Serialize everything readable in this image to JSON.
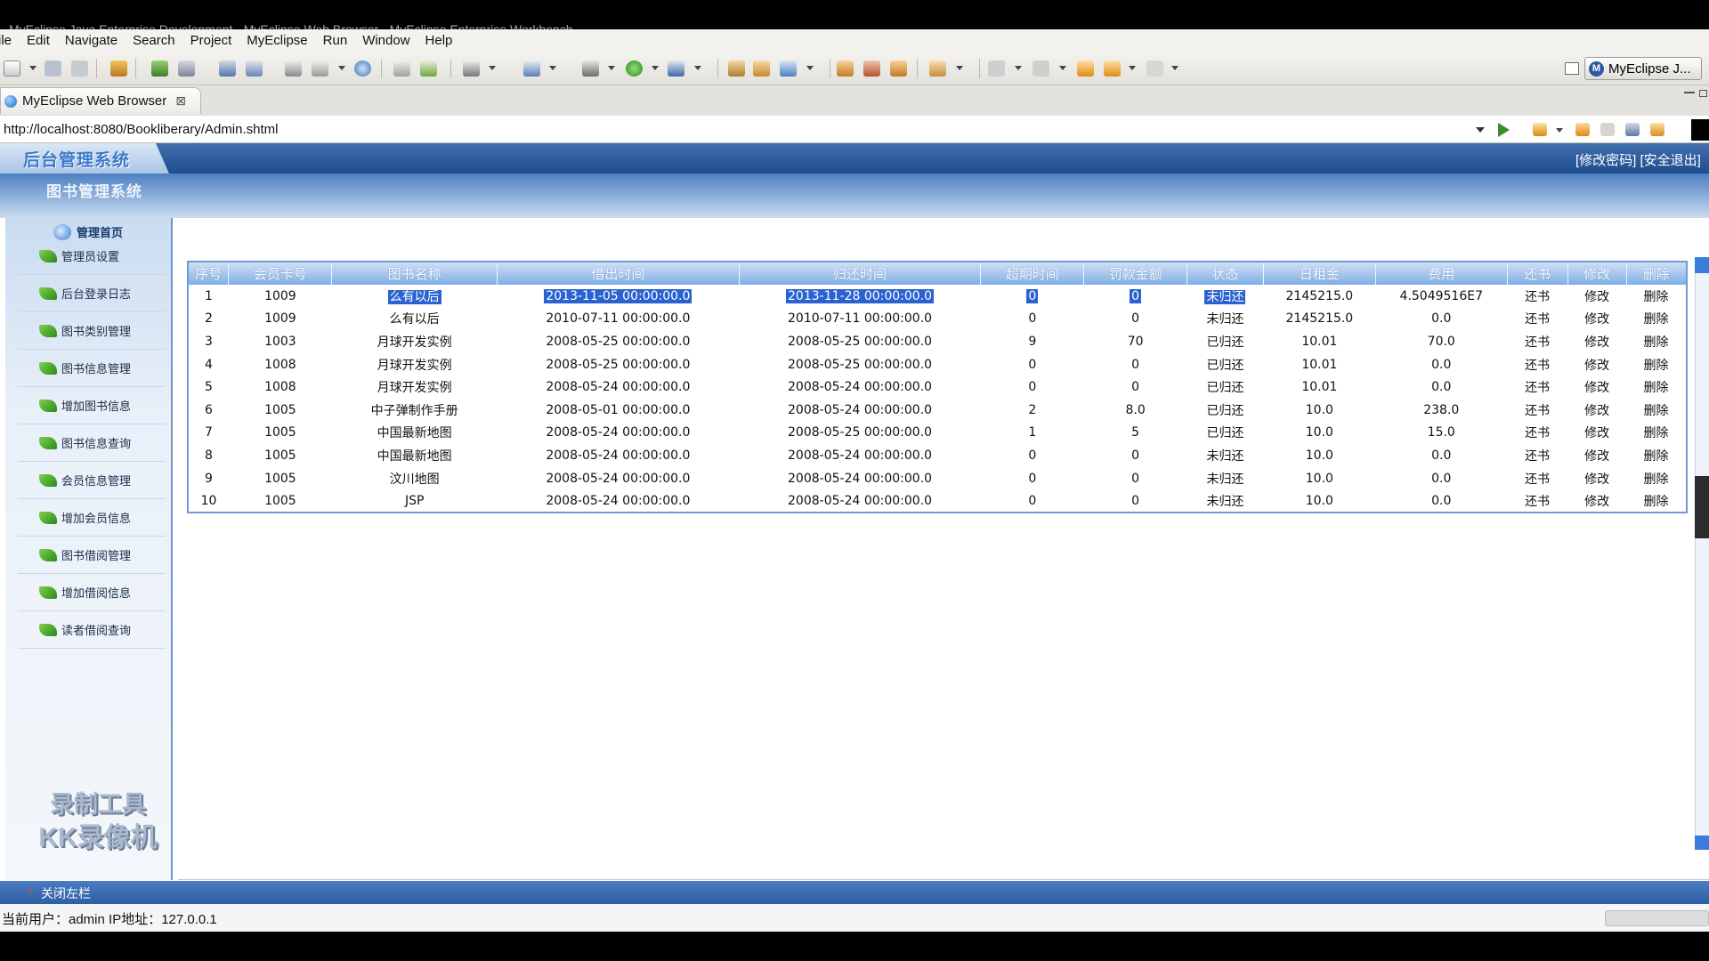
{
  "window": {
    "title": "MyEclipse Java Enterprise Development - MyEclipse Web Browser - MyEclipse Enterprise Workbench"
  },
  "menu": [
    "ile",
    "Edit",
    "Navigate",
    "Search",
    "Project",
    "MyEclipse",
    "Run",
    "Window",
    "Help"
  ],
  "perspective": {
    "label": "MyEclipse J...",
    "icon": "myeclipse-icon"
  },
  "editor_tab": {
    "label": "MyEclipse Web Browser",
    "close": "⊠"
  },
  "browser": {
    "url": "http://localhost:8080/Bookliberary/Admin.shtml"
  },
  "page": {
    "logo": "后台管理系统",
    "subtitle": "图书管理系统",
    "top_links": "[修改密码] [安全退出]",
    "sidebar": {
      "home": "管理首页",
      "items": [
        "管理员设置",
        "后台登录日志",
        "图书类别管理",
        "图书信息管理",
        "增加图书信息",
        "图书信息查询",
        "会员信息管理",
        "增加会员信息",
        "图书借阅管理",
        "增加借阅信息",
        "读者借阅查询"
      ]
    },
    "watermark": {
      "line1": "录制工具",
      "line2": "KK录像机"
    },
    "table": {
      "columns": [
        "序号",
        "会员卡号",
        "图书名称",
        "借出时间",
        "归还时间",
        "超期时间",
        "罚款金额",
        "状态",
        "日租金",
        "费用",
        "还书",
        "修改",
        "删除"
      ],
      "rows": [
        [
          "1",
          "1009",
          "么有以后",
          "2013-11-05 00:00:00.0",
          "2013-11-28 00:00:00.0",
          "0",
          "0",
          "未归还",
          "2145215.0",
          "4.5049516E7",
          "还书",
          "修改",
          "删除"
        ],
        [
          "2",
          "1009",
          "么有以后",
          "2010-07-11 00:00:00.0",
          "2010-07-11 00:00:00.0",
          "0",
          "0",
          "未归还",
          "2145215.0",
          "0.0",
          "还书",
          "修改",
          "删除"
        ],
        [
          "3",
          "1003",
          "月球开发实例",
          "2008-05-25 00:00:00.0",
          "2008-05-25 00:00:00.0",
          "9",
          "70",
          "已归还",
          "10.01",
          "70.0",
          "还书",
          "修改",
          "删除"
        ],
        [
          "4",
          "1008",
          "月球开发实例",
          "2008-05-25 00:00:00.0",
          "2008-05-25 00:00:00.0",
          "0",
          "0",
          "已归还",
          "10.01",
          "0.0",
          "还书",
          "修改",
          "删除"
        ],
        [
          "5",
          "1008",
          "月球开发实例",
          "2008-05-24 00:00:00.0",
          "2008-05-24 00:00:00.0",
          "0",
          "0",
          "已归还",
          "10.01",
          "0.0",
          "还书",
          "修改",
          "删除"
        ],
        [
          "6",
          "1005",
          "中子弹制作手册",
          "2008-05-01 00:00:00.0",
          "2008-05-24 00:00:00.0",
          "2",
          "8.0",
          "已归还",
          "10.0",
          "238.0",
          "还书",
          "修改",
          "删除"
        ],
        [
          "7",
          "1005",
          "中国最新地图",
          "2008-05-24 00:00:00.0",
          "2008-05-25 00:00:00.0",
          "1",
          "5",
          "已归还",
          "10.0",
          "15.0",
          "还书",
          "修改",
          "删除"
        ],
        [
          "8",
          "1005",
          "中国最新地图",
          "2008-05-24 00:00:00.0",
          "2008-05-24 00:00:00.0",
          "0",
          "0",
          "未归还",
          "10.0",
          "0.0",
          "还书",
          "修改",
          "删除"
        ],
        [
          "9",
          "1005",
          "汶川地图",
          "2008-05-24 00:00:00.0",
          "2008-05-24 00:00:00.0",
          "0",
          "0",
          "未归还",
          "10.0",
          "0.0",
          "还书",
          "修改",
          "删除"
        ],
        [
          "10",
          "1005",
          "JSP",
          "2008-05-24 00:00:00.0",
          "2008-05-24 00:00:00.0",
          "0",
          "0",
          "未归还",
          "10.0",
          "0.0",
          "还书",
          "修改",
          "删除"
        ]
      ],
      "highlighted_row": 1
    },
    "close_sidebar": "关闭左栏",
    "status": "当前用户：admin  IP地址：127.0.0.1"
  },
  "colors": {
    "header_blue": "#2d5fa5",
    "table_header": "#7faee4",
    "selection": "#2a62d1"
  }
}
